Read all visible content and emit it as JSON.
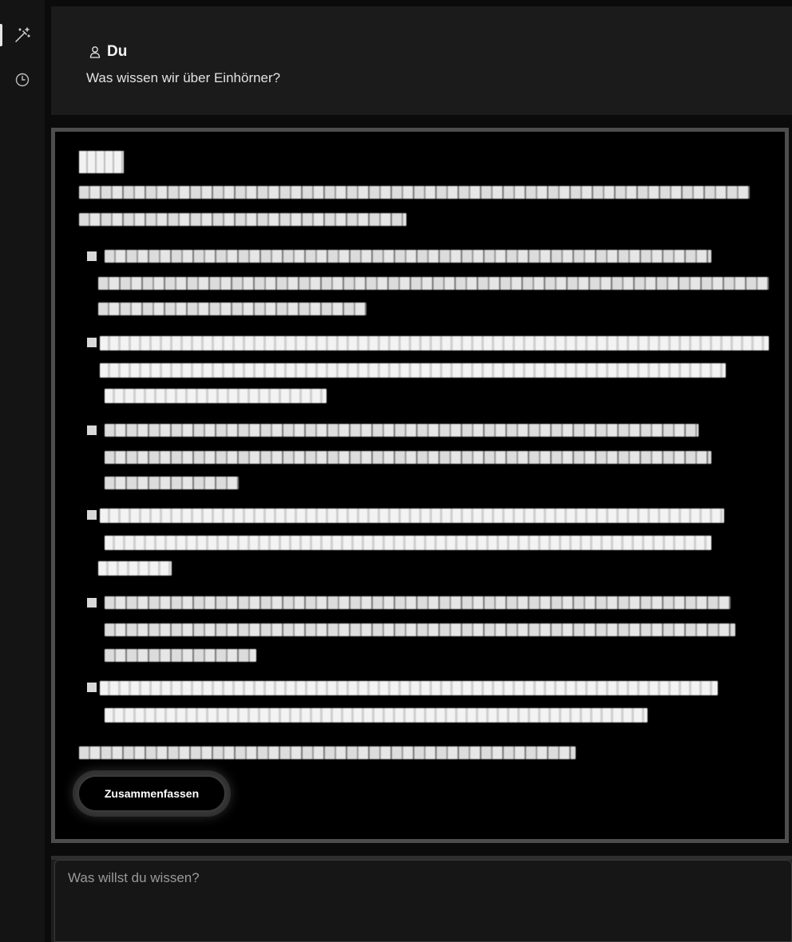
{
  "sidebar": {
    "items": [
      {
        "icon": "magic-wand-icon",
        "active": true
      },
      {
        "icon": "history-clock-icon",
        "active": false
      }
    ]
  },
  "user_message": {
    "author": "Du",
    "text": "Was wissen wir über Einhörner?"
  },
  "response": {
    "redacted": true,
    "summarize_label": "Zusammenfassen"
  },
  "input": {
    "placeholder": "Was willst du wissen?",
    "value": ""
  }
}
